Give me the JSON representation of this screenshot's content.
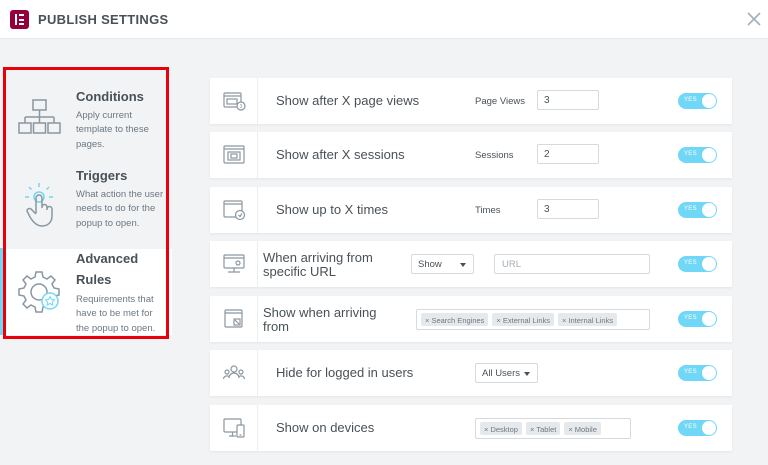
{
  "header": {
    "title": "PUBLISH SETTINGS"
  },
  "sidebar": {
    "items": [
      {
        "title": "Conditions",
        "desc": "Apply current template to these pages."
      },
      {
        "title": "Triggers",
        "desc": "What action the user needs to do for the popup to open."
      },
      {
        "title_line1": "Advanced",
        "title_line2": "Rules",
        "desc": "Requirements that have to be met for the popup to open."
      }
    ]
  },
  "rules": [
    {
      "label": "Show after X page views",
      "field_label": "Page Views",
      "value": "3",
      "toggle": "YES"
    },
    {
      "label": "Show after X sessions",
      "field_label": "Sessions",
      "value": "2",
      "toggle": "YES"
    },
    {
      "label": "Show up to X times",
      "field_label": "Times",
      "value": "3",
      "toggle": "YES"
    },
    {
      "label_line1": "When arriving from",
      "label_line2": "specific URL",
      "select": "Show",
      "placeholder": "URL",
      "toggle": "YES"
    },
    {
      "label_line1": "Show when arriving",
      "label_line2": "from",
      "tags": [
        "× Search Engines",
        "× External Links",
        "× Internal Links"
      ],
      "toggle": "YES"
    },
    {
      "label": "Hide for logged in users",
      "select": "All Users",
      "toggle": "YES"
    },
    {
      "label": "Show on devices",
      "tags": [
        "× Desktop",
        "× Tablet",
        "× Mobile"
      ],
      "toggle": "YES"
    }
  ]
}
